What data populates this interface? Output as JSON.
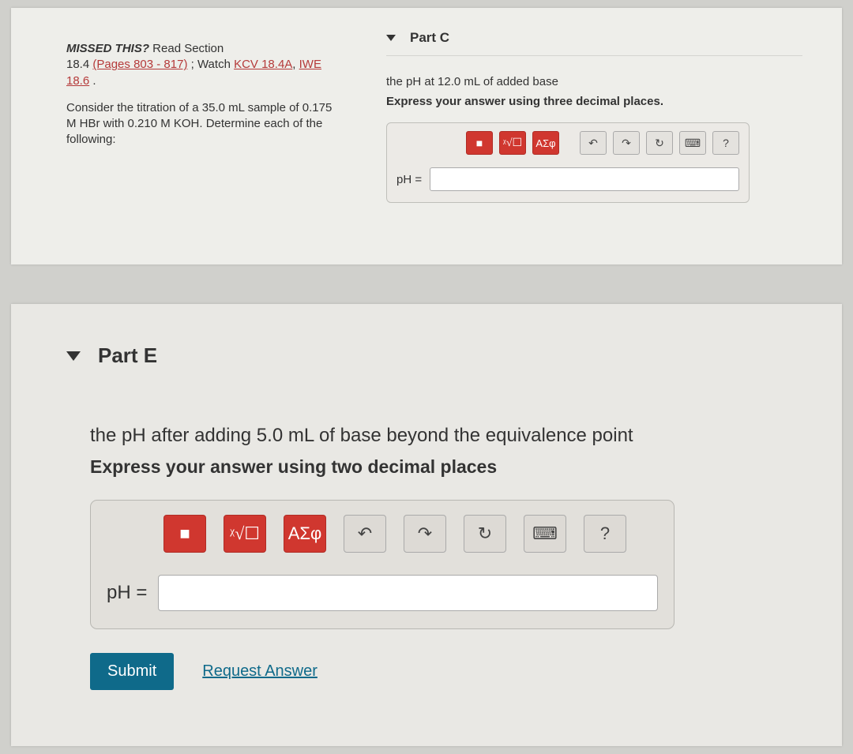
{
  "top": {
    "missed_label": "MISSED THIS?",
    "read_section": " Read Section",
    "section_prefix": "18.4 ",
    "pages_link": "(Pages 803 - 817)",
    "watch_prefix": " ; Watch ",
    "watch_link1": "KCV 18.4A",
    "watch_sep": ", ",
    "watch_link2": "IWE 18.6",
    "period": " .",
    "consider": "Consider the titration of a 35.0 mL sample of 0.175 M  HBr with 0.210 M KOH. Determine each of the following:",
    "partC": {
      "title": "Part C",
      "question": "the pH at 12.0 mL of added base",
      "instruction": "Express your answer using three decimal places.",
      "templates_btn": "■",
      "sqrt_btn": "ᵡ√☐",
      "greek_btn": "ΑΣφ",
      "undo": "↶",
      "redo": "↷",
      "reset": "↻",
      "keyboard": "⌨",
      "help": "?",
      "answer_label": "pH ="
    }
  },
  "bottom": {
    "partE": {
      "title": "Part E",
      "question": "the pH after adding 5.0 mL of base beyond the equivalence point",
      "instruction": "Express your answer using two decimal places",
      "templates_btn": "■",
      "sqrt_btn": "ᵡ√☐",
      "greek_btn": "ΑΣφ",
      "undo": "↶",
      "redo": "↷",
      "reset": "↻",
      "keyboard": "⌨",
      "help": "?",
      "answer_label": "pH =",
      "submit": "Submit",
      "request": "Request Answer"
    }
  }
}
